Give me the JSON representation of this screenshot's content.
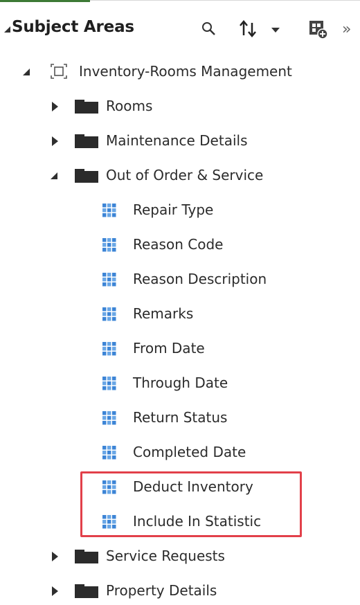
{
  "panel": {
    "title": "Subject Areas"
  },
  "tree": {
    "root": {
      "label": "Inventory-Rooms Management"
    },
    "folders": {
      "rooms": "Rooms",
      "maintenance_details": "Maintenance Details",
      "out_of_order_service": "Out of Order & Service",
      "service_requests": "Service Requests",
      "property_details": "Property Details"
    },
    "columns": [
      "Repair Type",
      "Reason Code",
      "Reason Description",
      "Remarks",
      "From Date",
      "Through Date",
      "Return Status",
      "Completed Date",
      "Deduct Inventory",
      "Include In Statistic"
    ]
  },
  "icons": {
    "search": "search-icon",
    "sort": "sort-icon",
    "add_subject_area": "add-subject-area-icon",
    "more": "double-chevron-right-icon"
  },
  "colors": {
    "highlight_border": "#e2404a",
    "table_icon": "#4a90d9",
    "folder": "#2b2b2b",
    "header_accent": "#3d7a35"
  }
}
